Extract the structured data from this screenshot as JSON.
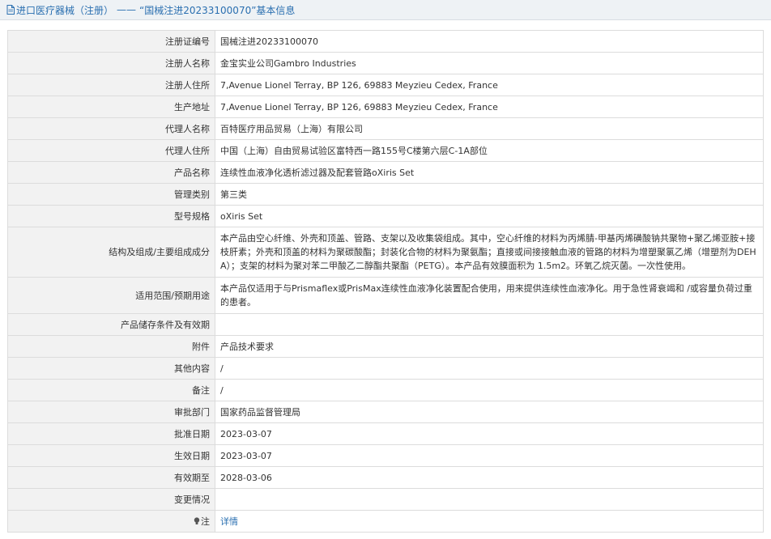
{
  "header": {
    "prefix": "进口医疗器械（注册）",
    "sep": "——",
    "title": "“国械注进20233100070”基本信息"
  },
  "rows": [
    {
      "label": "注册证编号",
      "value": "国械注进20233100070"
    },
    {
      "label": "注册人名称",
      "value": "金宝实业公司Gambro Industries"
    },
    {
      "label": "注册人住所",
      "value": "7,Avenue Lionel Terray, BP 126, 69883 Meyzieu Cedex, France"
    },
    {
      "label": "生产地址",
      "value": "7,Avenue Lionel Terray, BP 126, 69883 Meyzieu Cedex, France"
    },
    {
      "label": "代理人名称",
      "value": "百特医疗用品贸易（上海）有限公司"
    },
    {
      "label": "代理人住所",
      "value": "中国（上海）自由贸易试验区富特西一路155号C楼第六层C-1A部位"
    },
    {
      "label": "产品名称",
      "value": "连续性血液净化透析滤过器及配套管路oXiris Set"
    },
    {
      "label": "管理类别",
      "value": "第三类"
    },
    {
      "label": "型号规格",
      "value": "oXiris Set"
    },
    {
      "label": "结构及组成/主要组成成分",
      "value": "本产品由空心纤维、外壳和顶盖、管路、支架以及收集袋组成。其中，空心纤维的材料为丙烯腈-甲基丙烯磺酸钠共聚物+聚乙烯亚胺+接枝肝素；外壳和顶盖的材料为聚碳酸酯；封装化合物的材料为聚氨酯；直接或间接接触血液的管路的材料为增塑聚氯乙烯（增塑剂为DEHA）；支架的材料为聚对苯二甲酸乙二醇酯共聚酯（PETG）。本产品有效膜面积为 1.5m2。环氧乙烷灭菌。一次性使用。"
    },
    {
      "label": "适用范围/预期用途",
      "value": "本产品仅适用于与Prismaflex或PrisMax连续性血液净化装置配合使用，用来提供连续性血液净化。用于急性肾衰竭和 /或容量负荷过重的患者。"
    },
    {
      "label": "产品储存条件及有效期",
      "value": ""
    },
    {
      "label": "附件",
      "value": "产品技术要求"
    },
    {
      "label": "其他内容",
      "value": "/"
    },
    {
      "label": "备注",
      "value": "/"
    },
    {
      "label": "审批部门",
      "value": "国家药品监督管理局"
    },
    {
      "label": "批准日期",
      "value": "2023-03-07"
    },
    {
      "label": "生效日期",
      "value": "2023-03-07"
    },
    {
      "label": "有效期至",
      "value": "2028-03-06"
    },
    {
      "label": "变更情况",
      "value": ""
    },
    {
      "label": "注",
      "value": "详情"
    }
  ]
}
